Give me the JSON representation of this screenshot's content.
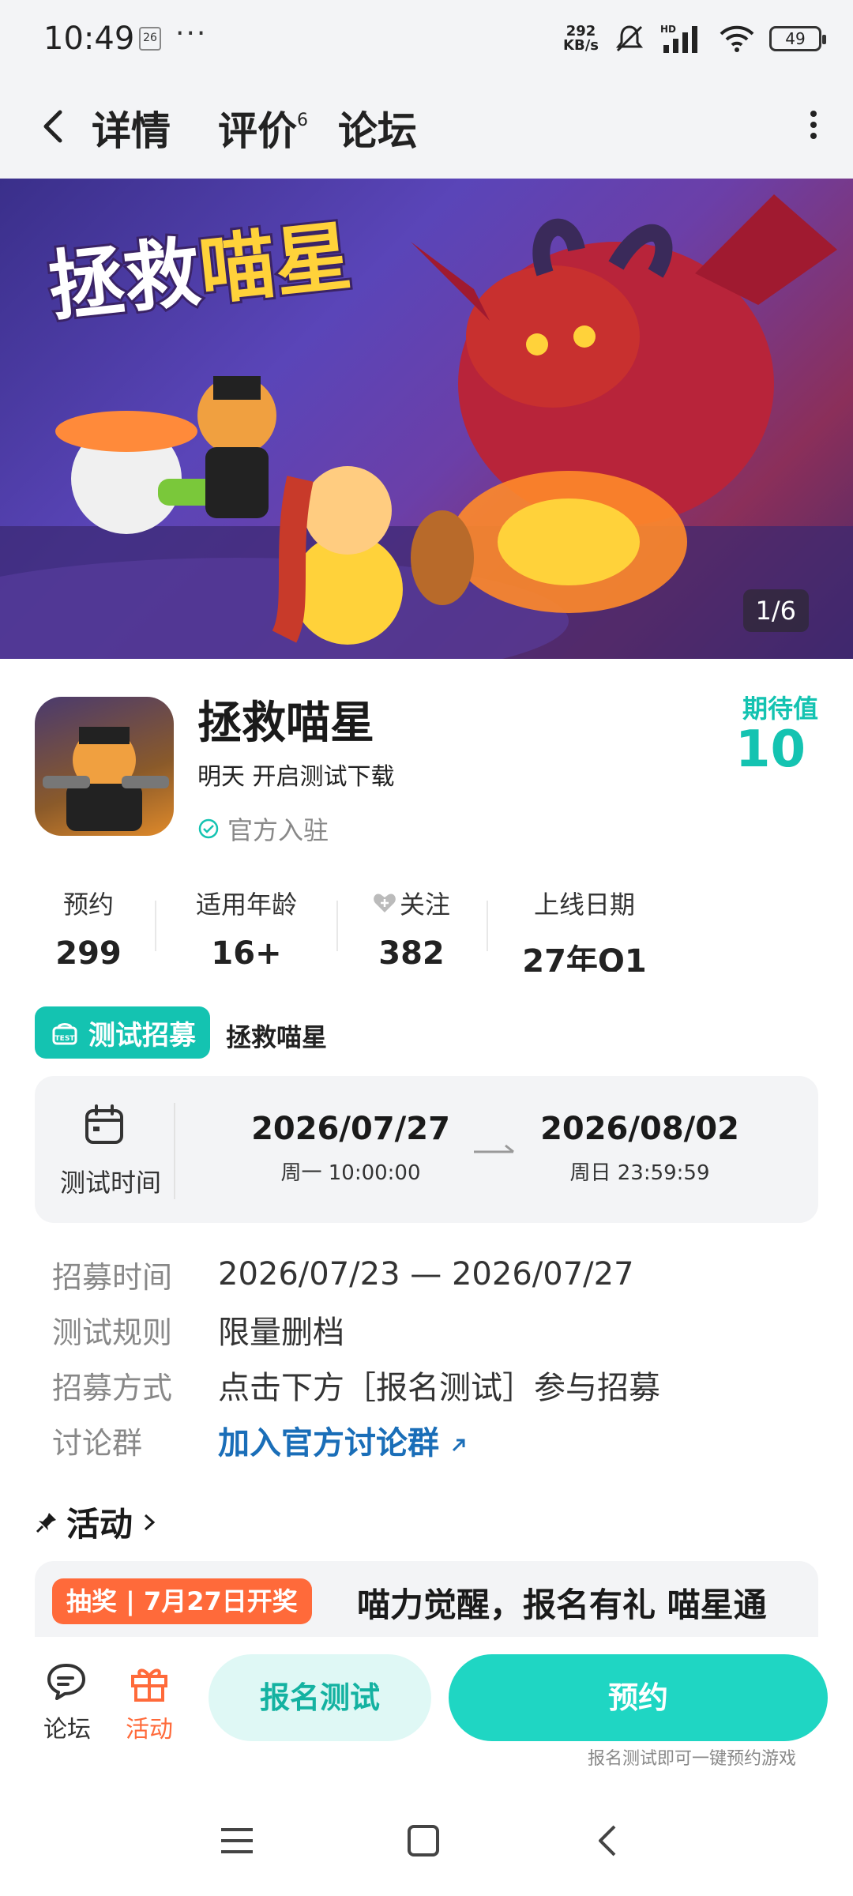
{
  "status_bar": {
    "time": "10:49",
    "calendar_day": "26",
    "dots": "···",
    "net_speed_value": "292",
    "net_speed_unit": "KB/s",
    "signal_label": "HD",
    "battery": "49"
  },
  "nav": {
    "tab_detail": "详情",
    "tab_review": "评价",
    "review_count": "6",
    "tab_forum": "论坛"
  },
  "banner": {
    "title_part1": "拯救",
    "title_part2": "喵星",
    "counter": "1/6"
  },
  "game": {
    "name": "拯救喵星",
    "subtitle": "明天 开启测试下载",
    "official": "官方入驻",
    "expect_label": "期待值",
    "expect_value": "10"
  },
  "stats": [
    {
      "label": "预约",
      "value": "299"
    },
    {
      "label": "适用年龄",
      "value": "16+"
    },
    {
      "label": "关注",
      "value": "382"
    },
    {
      "label": "上线日期",
      "value": "27年Q1"
    }
  ],
  "recruit": {
    "badge": "测试招募",
    "name": "拯救喵星",
    "test_time_label": "测试时间",
    "start_date": "2026/07/27",
    "start_time": "周一  10:00:00",
    "end_date": "2026/08/02",
    "end_time": "周日  23:59:59"
  },
  "info": {
    "recruit_time_key": "招募时间",
    "recruit_time_val": "2026/07/23 — 2026/07/27",
    "rule_key": "测试规则",
    "rule_val": "限量删档",
    "method_key": "招募方式",
    "method_val": "点击下方［报名测试］参与招募",
    "group_key": "讨论群",
    "group_val": "加入官方讨论群"
  },
  "activity": {
    "title": "活动",
    "tag": "抽奖 | 7月27日开奖",
    "text": "喵力觉醒，报名有礼 喵星通"
  },
  "bottom": {
    "forum_label": "论坛",
    "activity_label": "活动",
    "signup_button": "报名测试",
    "reserve_button": "预约",
    "hint": "报名测试即可一键预约游戏"
  },
  "colors": {
    "accent": "#1fd6c3",
    "accent_dark": "#14c3b1",
    "orange": "#ff6a3a",
    "link": "#1a6eb8"
  }
}
